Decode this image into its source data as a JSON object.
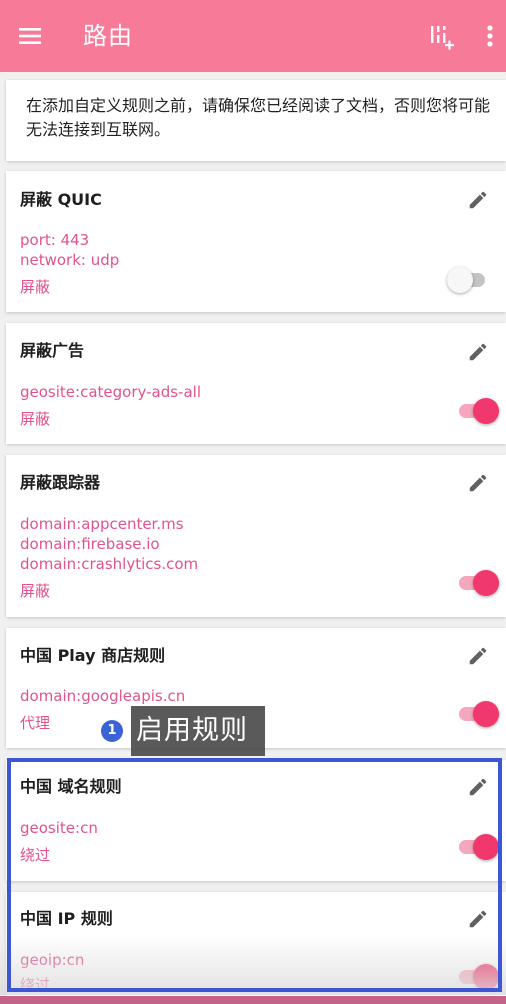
{
  "app_bar": {
    "title": "路由",
    "menu_icon": "hamburger-menu-icon",
    "filter_icon": "rule-filter-icon",
    "more_icon": "more-vert-icon",
    "color": "#f77a99"
  },
  "notice": {
    "text": "在添加自定义规则之前，请确保您已经阅读了文档，否则您将可能无法连接到互联网。"
  },
  "rules": [
    {
      "title": "屏蔽 QUIC",
      "lines": [
        "port: 443",
        "network: udp"
      ],
      "action": "屏蔽",
      "enabled": false
    },
    {
      "title": "屏蔽广告",
      "lines": [
        "geosite:category-ads-all"
      ],
      "action": "屏蔽",
      "enabled": true
    },
    {
      "title": "屏蔽跟踪器",
      "lines": [
        "domain:appcenter.ms",
        "domain:firebase.io",
        "domain:crashlytics.com"
      ],
      "action": "屏蔽",
      "enabled": true
    },
    {
      "title": "中国 Play 商店规则",
      "lines": [
        "domain:googleapis.cn"
      ],
      "action": "代理",
      "enabled": true
    },
    {
      "title": "中国 域名规则",
      "lines": [
        "geosite:cn"
      ],
      "action": "绕过",
      "enabled": true
    },
    {
      "title": "中国 IP 规则",
      "lines": [
        "geoip:cn"
      ],
      "action": "绕过",
      "enabled": true
    }
  ],
  "annotation": {
    "step": "1",
    "label": "启用规则",
    "highlight_color": "#3d57d4"
  },
  "colors": {
    "accent": "#f1386c",
    "rule_text": "#e1538f",
    "toggle_on": "#f1386c",
    "toggle_off": "#c4c4c4"
  }
}
